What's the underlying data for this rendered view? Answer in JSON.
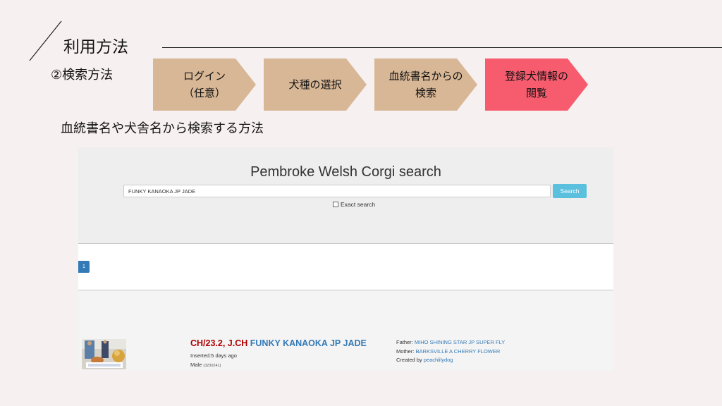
{
  "slide": {
    "title": "利用方法",
    "subtitle": "②検索方法",
    "description": "血統書名や犬舎名から検索する方法"
  },
  "steps": [
    {
      "label": "ログイン\n（任意）",
      "color": "#d8b796"
    },
    {
      "label": "犬種の選択",
      "color": "#d8b796"
    },
    {
      "label": "血統書名からの\n検索",
      "color": "#d8b796"
    },
    {
      "label": "登録犬情報の\n閲覧",
      "color": "#f65c6e"
    }
  ],
  "site": {
    "search_title": "Pembroke Welsh Corgi search",
    "search_value": "FUNKY KANAOKA JP JADE",
    "search_button": "Search",
    "exact_label": "Exact search",
    "page_number": "1",
    "result": {
      "title_prefix": "CH/23.2, J.CH",
      "name": "FUNKY KANAOKA JP JADE",
      "inserted": "Inserted:5 days ago",
      "sex": "Male",
      "reg_no": "(3230241)",
      "father_label": "Father:",
      "father": "MIHO SHINING STAR JP SUPER FLY",
      "mother_label": "Mother:",
      "mother": "BARKSVILLE A CHERRY FLOWER",
      "created_label": "Created by",
      "created_by": "peachlilydog"
    }
  }
}
